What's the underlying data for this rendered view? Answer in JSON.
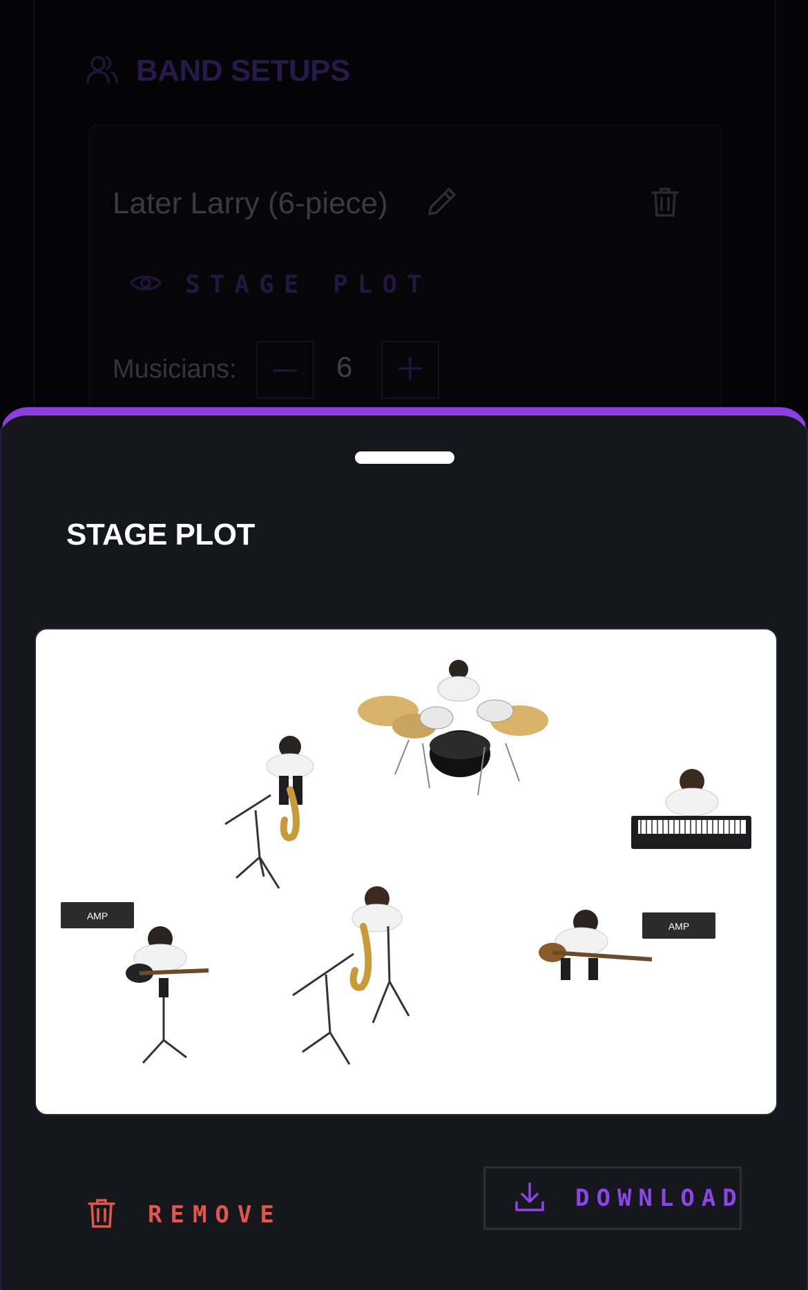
{
  "background": {
    "section_title": "BAND SETUPS",
    "setup": {
      "name": "Later Larry (6-piece)",
      "stage_plot_link_label": "STAGE PLOT",
      "musicians_label": "Musicians:",
      "musicians_count": "6"
    }
  },
  "sheet": {
    "title": "STAGE PLOT",
    "plot": {
      "amp_labels": [
        "AMP",
        "AMP"
      ]
    },
    "remove_label": "REMOVE",
    "download_label": "DOWNLOAD"
  },
  "colors": {
    "accent": "#8a3fe0",
    "danger": "#e2574c",
    "sheet_bg": "#16161d"
  },
  "icons": [
    "users-icon",
    "pencil-icon",
    "trash-icon",
    "eye-icon",
    "minus-icon",
    "plus-icon",
    "download-icon"
  ]
}
